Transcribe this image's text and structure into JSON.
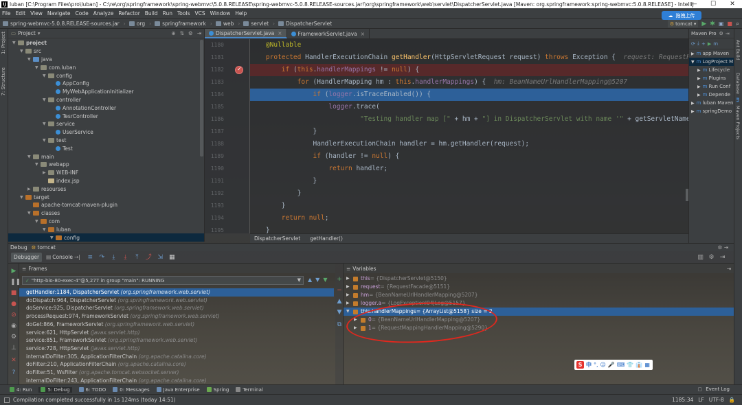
{
  "window": {
    "title": "luban [C:\\Program Files\\pro\\luban] - C:\\re\\org\\springframework\\spring-webmvc\\5.0.8.RELEASE\\spring-webmvc-5.0.8.RELEASE-sources.jar!\\org\\springframework\\web\\servlet\\DispatcherServlet.java [Maven: org.springframework:spring-webmvc:5.0.8.RELEASE] - IntelliJ",
    "minimize": "—",
    "maximize": "☐",
    "close": "✕"
  },
  "menu": [
    "File",
    "Edit",
    "View",
    "Navigate",
    "Code",
    "Analyze",
    "Refactor",
    "Build",
    "Run",
    "Tools",
    "VCS",
    "Window",
    "Help"
  ],
  "nav": {
    "crumbs": [
      "spring-webmvc-5.0.8.RELEASE-sources.jar",
      "org",
      "springframework",
      "web",
      "servlet",
      "DispatcherServlet"
    ],
    "run_config": "tomcat",
    "upload_button": "拖拽上传"
  },
  "left_tabs": [
    "1: Project",
    "7: Structure"
  ],
  "project": {
    "header": "Project",
    "tree": [
      {
        "label": "project",
        "indent": 0,
        "arrow": "▼",
        "icon": "folder",
        "bold": true
      },
      {
        "label": "src",
        "indent": 1,
        "arrow": "▼",
        "icon": "folder"
      },
      {
        "label": "java",
        "indent": 2,
        "arrow": "▼",
        "icon": "src"
      },
      {
        "label": "com.luban",
        "indent": 3,
        "arrow": "▼",
        "icon": "pkg"
      },
      {
        "label": "config",
        "indent": 4,
        "arrow": "▼",
        "icon": "pkg"
      },
      {
        "label": "AppConfig",
        "indent": 5,
        "arrow": "",
        "icon": "class"
      },
      {
        "label": "MyWebApplicationInitializer",
        "indent": 5,
        "arrow": "",
        "icon": "class"
      },
      {
        "label": "controller",
        "indent": 4,
        "arrow": "▼",
        "icon": "pkg"
      },
      {
        "label": "AnnotationController",
        "indent": 5,
        "arrow": "",
        "icon": "class"
      },
      {
        "label": "TesrController",
        "indent": 5,
        "arrow": "",
        "icon": "class"
      },
      {
        "label": "service",
        "indent": 4,
        "arrow": "▼",
        "icon": "pkg"
      },
      {
        "label": "UserService",
        "indent": 5,
        "arrow": "",
        "icon": "class"
      },
      {
        "label": "test",
        "indent": 4,
        "arrow": "▼",
        "icon": "pkg"
      },
      {
        "label": "Test",
        "indent": 5,
        "arrow": "",
        "icon": "class"
      },
      {
        "label": "main",
        "indent": 2,
        "arrow": "▼",
        "icon": "folder"
      },
      {
        "label": "webapp",
        "indent": 3,
        "arrow": "▼",
        "icon": "folder"
      },
      {
        "label": "WEB-INF",
        "indent": 4,
        "arrow": "▶",
        "icon": "folder"
      },
      {
        "label": "index.jsp",
        "indent": 4,
        "arrow": "",
        "icon": "file"
      },
      {
        "label": "resourses",
        "indent": 2,
        "arrow": "▶",
        "icon": "folder"
      },
      {
        "label": "target",
        "indent": 1,
        "arrow": "▼",
        "icon": "orange"
      },
      {
        "label": "apache-tomcat-maven-plugin",
        "indent": 2,
        "arrow": "",
        "icon": "orange"
      },
      {
        "label": "classes",
        "indent": 2,
        "arrow": "▼",
        "icon": "orange"
      },
      {
        "label": "com",
        "indent": 3,
        "arrow": "▼",
        "icon": "orange"
      },
      {
        "label": "luban",
        "indent": 4,
        "arrow": "▼",
        "icon": "orange"
      },
      {
        "label": "config",
        "indent": 5,
        "arrow": "▼",
        "icon": "orange",
        "selected": true
      }
    ]
  },
  "editor": {
    "tabs": [
      {
        "label": "DispatcherServlet.java",
        "active": true
      },
      {
        "label": "FrameworkServlet.java",
        "active": false
      }
    ],
    "line_numbers": [
      "1180",
      "1181",
      "1182",
      "1183",
      "1184",
      "1185",
      "1186",
      "1187",
      "1188",
      "1189",
      "1190",
      "1191",
      "1192",
      "1193",
      "1194",
      "1195"
    ],
    "breadcrumb": [
      "DispatcherServlet",
      "getHandler()"
    ]
  },
  "maven": {
    "header": "Maven Pro",
    "items": [
      {
        "label": "app Maven",
        "indent": 0,
        "arrow": "▶"
      },
      {
        "label": "LogProject M",
        "indent": 0,
        "arrow": "▼",
        "selected": true
      },
      {
        "label": "Lifecycle",
        "indent": 1,
        "arrow": "▶"
      },
      {
        "label": "Plugins",
        "indent": 1,
        "arrow": "▶"
      },
      {
        "label": "Run Conf",
        "indent": 1,
        "arrow": "▶"
      },
      {
        "label": "Depende",
        "indent": 1,
        "arrow": "▶"
      },
      {
        "label": "luban Maven",
        "indent": 0,
        "arrow": "▶"
      },
      {
        "label": "springDemo",
        "indent": 0,
        "arrow": "▶"
      }
    ]
  },
  "right_tabs": [
    "Ant Build",
    "Database",
    "m",
    "Maven Projects"
  ],
  "debug": {
    "title_prefix": "Debug",
    "config": "tomcat",
    "tabs": [
      "Debugger",
      "Console"
    ],
    "frames_header": "Frames",
    "thread": "\"http-bio-80-exec-4\"@5,277 in group \"main\": RUNNING",
    "frames": [
      {
        "method": "getHandler:1184, DispatcherServlet",
        "pkg": "(org.springframework.web.servlet)",
        "selected": true
      },
      {
        "method": "doDispatch:964, DispatcherServlet",
        "pkg": "(org.springframework.web.servlet)"
      },
      {
        "method": "doService:925, DispatcherServlet",
        "pkg": "(org.springframework.web.servlet)"
      },
      {
        "method": "processRequest:974, FrameworkServlet",
        "pkg": "(org.springframework.web.servlet)"
      },
      {
        "method": "doGet:866, FrameworkServlet",
        "pkg": "(org.springframework.web.servlet)"
      },
      {
        "method": "service:621, HttpServlet",
        "pkg": "(javax.servlet.http)"
      },
      {
        "method": "service:851, FrameworkServlet",
        "pkg": "(org.springframework.web.servlet)"
      },
      {
        "method": "service:728, HttpServlet",
        "pkg": "(javax.servlet.http)"
      },
      {
        "method": "internalDoFilter:305, ApplicationFilterChain",
        "pkg": "(org.apache.catalina.core)"
      },
      {
        "method": "doFilter:210, ApplicationFilterChain",
        "pkg": "(org.apache.catalina.core)"
      },
      {
        "method": "doFilter:51, WsFilter",
        "pkg": "(org.apache.tomcat.websocket.server)"
      },
      {
        "method": "internalDoFilter:243, ApplicationFilterChain",
        "pkg": "(org.apache.catalina.core)"
      }
    ],
    "variables_header": "Variables",
    "variables": [
      {
        "name": "this",
        "value": " = {DispatcherServlet@5150}",
        "indent": 0,
        "arrow": "▶"
      },
      {
        "name": "request",
        "value": " = {RequestFacade@5151}",
        "indent": 0,
        "arrow": "▶"
      },
      {
        "name": "hm",
        "value": " = {BeanNameUrlHandlerMapping@5207}",
        "indent": 0,
        "arrow": "▶"
      },
      {
        "name": "logger.a",
        "value": " = {LogExceptionl04JLog@5157}",
        "indent": 0,
        "arrow": "▶"
      },
      {
        "name": "this.handlerMappings",
        "value": " = {ArrayList@5158}  size = 2",
        "indent": 0,
        "arrow": "▼",
        "selected": true
      },
      {
        "name": "0",
        "value": " = {BeanNameUrlHandlerMapping@5207}",
        "indent": 1,
        "arrow": "▶"
      },
      {
        "name": "1",
        "value": " = {RequestMappingHandlerMapping@5290}",
        "indent": 1,
        "arrow": "▶"
      }
    ]
  },
  "ime": {
    "logo": "S",
    "chars": [
      "中",
      "°,",
      "☺",
      "🎤",
      "⌨",
      "👕",
      "👔",
      "▦"
    ]
  },
  "toolwindows": [
    {
      "label": "4: Run",
      "color": "#4e9a4e"
    },
    {
      "label": "5: Debug",
      "color": "#4e9a4e",
      "active": true
    },
    {
      "label": "6: TODO",
      "color": "#6a8ab0"
    },
    {
      "label": "0: Messages",
      "color": "#6a8ab0"
    },
    {
      "label": "Java Enterprise",
      "color": "#6a8ab0"
    },
    {
      "label": "Spring",
      "color": "#6aa84f"
    },
    {
      "label": "Terminal",
      "color": "#888888"
    }
  ],
  "event_log": "Event Log",
  "status": {
    "message": "Compilation completed successfully in 1s 124ms (today 14:51)",
    "position": "1185:34",
    "line_sep": "LF",
    "encoding": "UTF-8"
  },
  "colors": {
    "selection": "#2d6099",
    "breakpoint": "#c75450",
    "annotation": "#e0281e"
  }
}
